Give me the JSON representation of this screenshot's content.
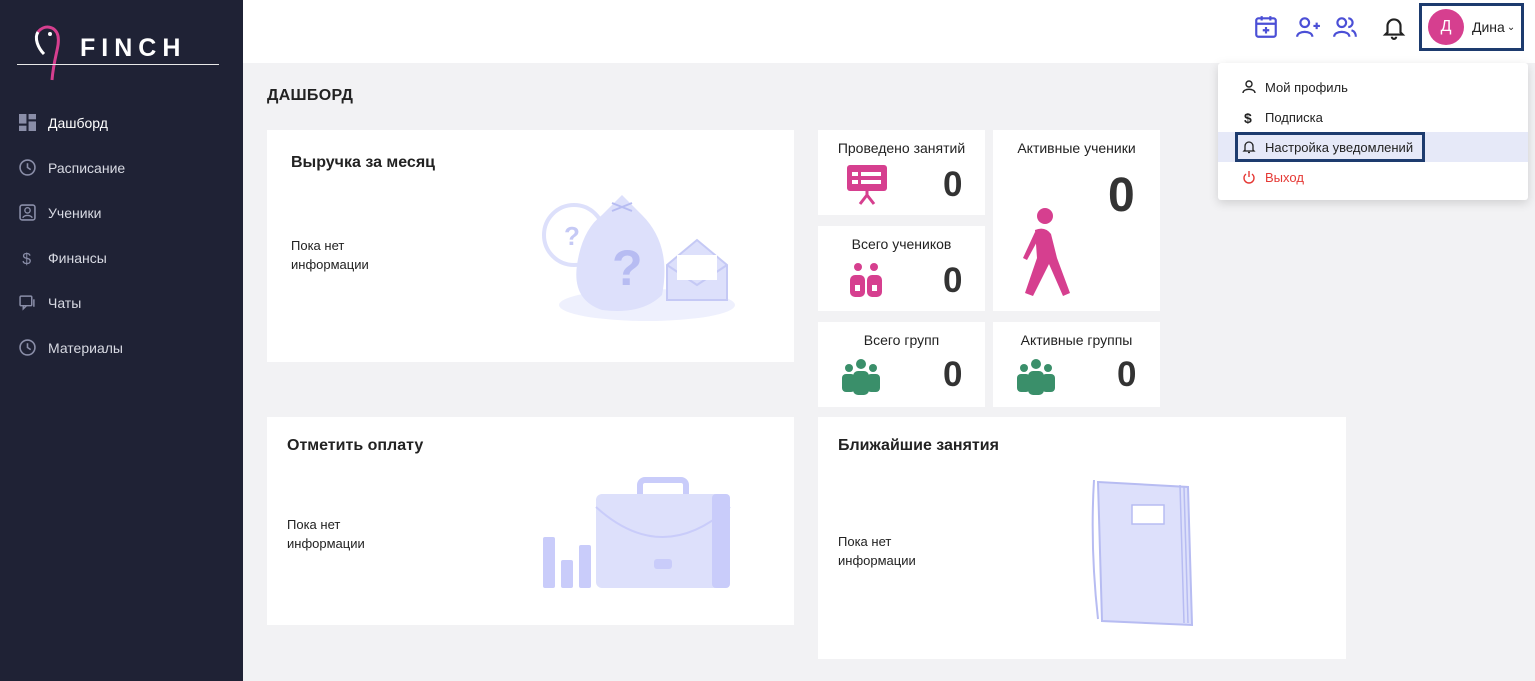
{
  "brand": {
    "name": "FINCH"
  },
  "sidebar": {
    "items": [
      {
        "label": "Дашборд",
        "icon": "dashboard-icon"
      },
      {
        "label": "Расписание",
        "icon": "clock-icon"
      },
      {
        "label": "Ученики",
        "icon": "student-icon"
      },
      {
        "label": "Финансы",
        "icon": "dollar-icon"
      },
      {
        "label": "Чаты",
        "icon": "chat-icon"
      },
      {
        "label": "Материалы",
        "icon": "clock-icon"
      }
    ]
  },
  "header": {
    "icons": [
      "calendar-add-icon",
      "user-add-icon",
      "users-icon",
      "bell-icon"
    ],
    "user": {
      "initial": "Д",
      "name": "Дина"
    }
  },
  "page": {
    "title": "ДАШБОРД"
  },
  "revenue_card": {
    "title": "Выручка за месяц",
    "empty_text": "Пока нет информации"
  },
  "payment_card": {
    "title": "Отметить оплату",
    "empty_text": "Пока нет информации"
  },
  "upcoming_card": {
    "title": "Ближайшие занятия",
    "empty_text": "Пока нет информации"
  },
  "stats": {
    "lessons": {
      "label": "Проведено занятий",
      "value": "0"
    },
    "active_students": {
      "label": "Активные ученики",
      "value": "0"
    },
    "total_students": {
      "label": "Всего учеников",
      "value": "0"
    },
    "total_groups": {
      "label": "Всего групп",
      "value": "0"
    },
    "active_groups": {
      "label": "Активные группы",
      "value": "0"
    }
  },
  "dropdown": {
    "items": [
      {
        "label": "Мой профиль",
        "icon": "person-icon"
      },
      {
        "label": "Подписка",
        "icon": "dollar-icon"
      },
      {
        "label": "Настройка уведомлений",
        "icon": "bell-icon"
      },
      {
        "label": "Выход",
        "icon": "power-icon"
      }
    ]
  },
  "colors": {
    "sidebar_bg": "#1f2235",
    "accent_pink": "#d63f8f",
    "accent_indigo": "#4b4fd6",
    "accent_green": "#3a8f6a",
    "focus_border": "#1d3b6e",
    "logout_red": "#e53935",
    "illustration": "#dde0fb"
  }
}
